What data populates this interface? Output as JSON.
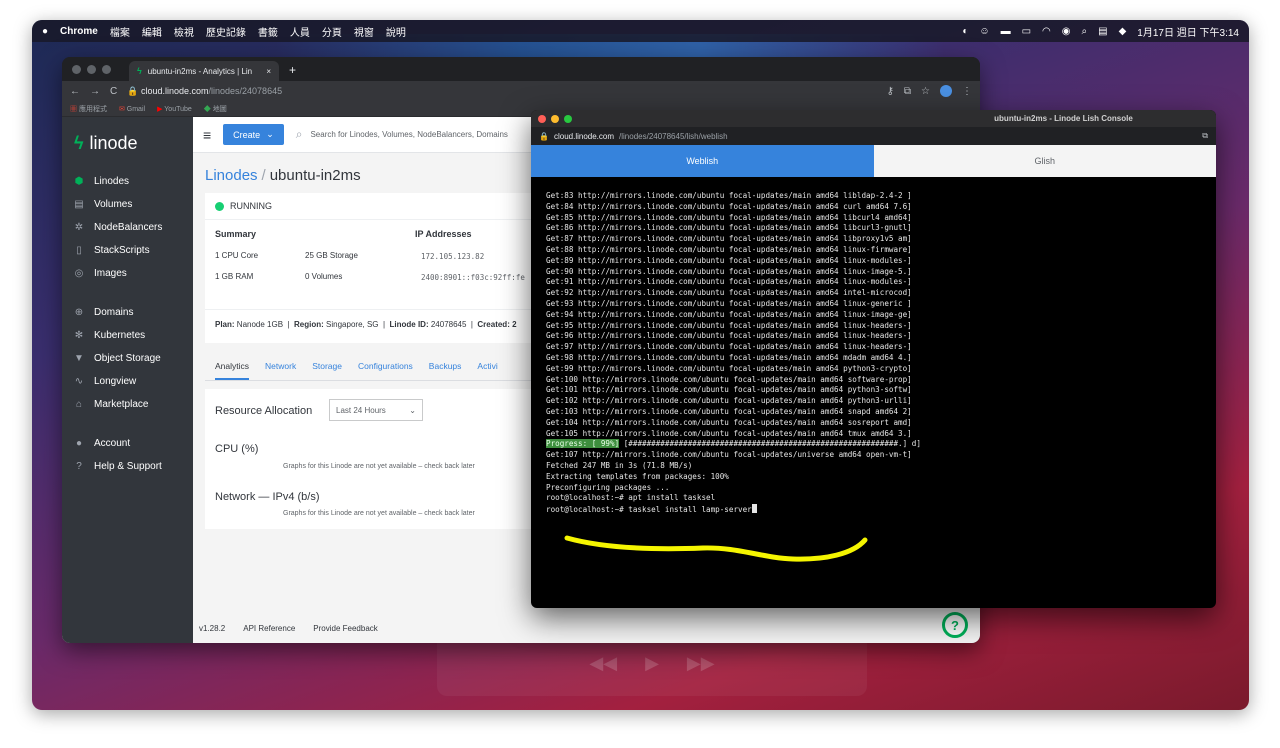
{
  "menubar": {
    "apple": "",
    "items": [
      "Chrome",
      "檔案",
      "編輯",
      "檢視",
      "歷史記錄",
      "書籤",
      "人員",
      "分頁",
      "視窗",
      "說明"
    ],
    "datetime": "1月17日 週日 下午3:14"
  },
  "chrome": {
    "tab_title": "ubuntu-in2ms - Analytics | Lin",
    "tab_close": "×",
    "new_tab": "+",
    "url_host": "cloud.linode.com",
    "url_path": "/linodes/24078645",
    "bookmarks": [
      "應用程式",
      "Gmail",
      "YouTube",
      "地圖"
    ]
  },
  "linode": {
    "logo": "linode",
    "nav": [
      {
        "label": "Linodes",
        "icon": "linode-icon"
      },
      {
        "label": "Volumes",
        "icon": "volume-icon"
      },
      {
        "label": "NodeBalancers",
        "icon": "nodebalancer-icon"
      },
      {
        "label": "StackScripts",
        "icon": "stackscript-icon"
      },
      {
        "label": "Images",
        "icon": "image-icon"
      },
      {
        "label": "Domains",
        "icon": "globe-icon"
      },
      {
        "label": "Kubernetes",
        "icon": "kubernetes-icon"
      },
      {
        "label": "Object Storage",
        "icon": "bucket-icon"
      },
      {
        "label": "Longview",
        "icon": "pulse-icon"
      },
      {
        "label": "Marketplace",
        "icon": "marketplace-icon"
      },
      {
        "label": "Account",
        "icon": "account-icon"
      },
      {
        "label": "Help & Support",
        "icon": "help-icon"
      }
    ],
    "create_label": "Create",
    "search_placeholder": "Search for Linodes, Volumes, NodeBalancers, Domains",
    "breadcrumb_parent": "Linodes",
    "breadcrumb_current": "ubuntu-in2ms",
    "status": "RUNNING",
    "summary_label": "Summary",
    "ip_label": "IP Addresses",
    "cpu": "1 CPU Core",
    "storage": "25 GB Storage",
    "ram": "1 GB RAM",
    "volumes": "0 Volumes",
    "ipv4": "172.105.123.82",
    "ipv6": "2400:8901::f03c:92ff:fe",
    "plan_label": "Plan:",
    "plan_value": "Nanode 1GB",
    "region_label": "Region:",
    "region_value": "Singapore, SG",
    "id_label": "Linode ID:",
    "id_value": "24078645",
    "created_label": "Created: 2",
    "tabs": [
      "Analytics",
      "Network",
      "Storage",
      "Configurations",
      "Backups",
      "Activi"
    ],
    "resource_allocation": "Resource Allocation",
    "range_select": "Last 24 Hours",
    "cpu_title": "CPU (%)",
    "cpu_na": "Graphs for this Linode are not yet available – check back later",
    "net_title": "Network — IPv4 (b/s)",
    "net_na": "Graphs for this Linode are not yet available – check back later",
    "footer_version": "v1.28.2",
    "footer_api": "API Reference",
    "footer_feedback": "Provide Feedback",
    "help_fab": "?"
  },
  "lish": {
    "title": "ubuntu-in2ms - Linode Lish Console",
    "url_host": "cloud.linode.com",
    "url_path": "/linodes/24078645/lish/weblish",
    "tab_weblish": "Weblish",
    "tab_glish": "Glish",
    "lines": [
      "Get:83 http://mirrors.linode.com/ubuntu focal-updates/main amd64 libldap-2.4-2 ]",
      "Get:84 http://mirrors.linode.com/ubuntu focal-updates/main amd64 curl amd64 7.6]",
      "Get:85 http://mirrors.linode.com/ubuntu focal-updates/main amd64 libcurl4 amd64]",
      "Get:86 http://mirrors.linode.com/ubuntu focal-updates/main amd64 libcurl3-gnutl]",
      "Get:87 http://mirrors.linode.com/ubuntu focal-updates/main amd64 libproxy1v5 am]",
      "Get:88 http://mirrors.linode.com/ubuntu focal-updates/main amd64 linux-firmware]",
      "Get:89 http://mirrors.linode.com/ubuntu focal-updates/main amd64 linux-modules-]",
      "Get:90 http://mirrors.linode.com/ubuntu focal-updates/main amd64 linux-image-5.]",
      "Get:91 http://mirrors.linode.com/ubuntu focal-updates/main amd64 linux-modules-]",
      "Get:92 http://mirrors.linode.com/ubuntu focal-updates/main amd64 intel-microcod]",
      "Get:93 http://mirrors.linode.com/ubuntu focal-updates/main amd64 linux-generic ]",
      "Get:94 http://mirrors.linode.com/ubuntu focal-updates/main amd64 linux-image-ge]",
      "Get:95 http://mirrors.linode.com/ubuntu focal-updates/main amd64 linux-headers-]",
      "Get:96 http://mirrors.linode.com/ubuntu focal-updates/main amd64 linux-headers-]",
      "Get:97 http://mirrors.linode.com/ubuntu focal-updates/main amd64 linux-headers-]",
      "Get:98 http://mirrors.linode.com/ubuntu focal-updates/main amd64 mdadm amd64 4.]",
      "Get:99 http://mirrors.linode.com/ubuntu focal-updates/main amd64 python3-crypto]",
      "Get:100 http://mirrors.linode.com/ubuntu focal-updates/main amd64 software-prop]",
      "Get:101 http://mirrors.linode.com/ubuntu focal-updates/main amd64 python3-softw]",
      "Get:102 http://mirrors.linode.com/ubuntu focal-updates/main amd64 python3-urlli]",
      "Get:103 http://mirrors.linode.com/ubuntu focal-updates/main amd64 snapd amd64 2]",
      "Get:104 http://mirrors.linode.com/ubuntu focal-updates/main amd64 sosreport amd]",
      "Get:105 http://mirrors.linode.com/ubuntu focal-updates/main amd64 tmux amd64 3.]"
    ],
    "progress_label": "Progress: [ 99%]",
    "progress_bar": " [###########################################################.] d]",
    "lines_after": [
      "Get:107 http://mirrors.linode.com/ubuntu focal-updates/universe amd64 open-vm-t]",
      "Fetched 247 MB in 3s (71.8 MB/s)",
      "Extracting templates from packages: 100%",
      "Preconfiguring packages ...",
      "root@localhost:~# apt install tasksel",
      "root@localhost:~# tasksel install lamp-server"
    ]
  },
  "colors": {
    "linode_green": "#00b159",
    "linode_blue": "#3683dc",
    "highlight_yellow": "#f5f500"
  }
}
